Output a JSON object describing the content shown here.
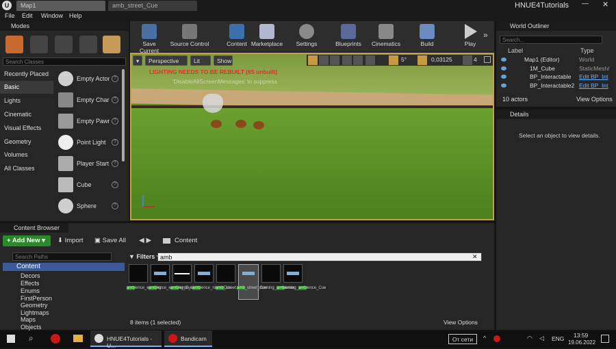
{
  "titlebar": {
    "tabs": [
      {
        "label": "Map1"
      },
      {
        "label": "amb_street_Cue"
      }
    ],
    "project": "HNUE4Tutorials"
  },
  "menu": [
    "File",
    "Edit",
    "Window",
    "Help"
  ],
  "modes": {
    "title": "Modes",
    "search_placeholder": "Search Classes",
    "categories": [
      "Recently Placed",
      "Basic",
      "Lights",
      "Cinematic",
      "Visual Effects",
      "Geometry",
      "Volumes",
      "All Classes"
    ],
    "items": [
      "Empty Actor",
      "Empty Chara",
      "Empty Pawn",
      "Point Light",
      "Player Start",
      "Cube",
      "Sphere"
    ]
  },
  "toolbar": [
    "Save Current",
    "Source Control",
    "Content",
    "Marketplace",
    "Settings",
    "Blueprints",
    "Cinematics",
    "Build",
    "Play"
  ],
  "viewport": {
    "perspective": "Perspective",
    "lit": "Lit",
    "show": "Show",
    "warning": "LIGHTING NEEDS TO BE REBUILT (65 unbuilt)",
    "suppress": "'DisableAllScreenMessages' to suppress",
    "snap_angle": "5°",
    "scale": "0,03125",
    "camera_speed": "4"
  },
  "outliner": {
    "title": "World Outliner",
    "search_placeholder": "Search...",
    "col_label": "Label",
    "col_type": "Type",
    "rows": [
      {
        "label": "Map1 (Editor)",
        "type": "World"
      },
      {
        "label": "1M_Cube",
        "type": "StaticMesh/"
      },
      {
        "label": "BP_Interactable",
        "type": "Edit BP_Int"
      },
      {
        "label": "BP_Interactable2",
        "type": "Edit BP_Int"
      }
    ],
    "count": "10 actors",
    "view_options": "View Options"
  },
  "details": {
    "title": "Details",
    "empty": "Select an object to view details."
  },
  "content_browser": {
    "title": "Content Browser",
    "add_new": "Add New",
    "import": "Import",
    "save_all": "Save All",
    "path": "Content",
    "search_paths": "Search Paths",
    "filters": "Filters",
    "search_value": "amb",
    "tree": [
      "Content",
      "Decors",
      "Effects",
      "Enums",
      "FirstPerson",
      "Geometry",
      "Lightmaps",
      "Maps",
      "Objects"
    ],
    "assets": [
      {
        "hl": "amb",
        "rest": "ience_evening"
      },
      {
        "hl": "amb",
        "rest": "ience_evening_Cue"
      },
      {
        "hl": "amb",
        "rest": "ience_night"
      },
      {
        "hl": "amb",
        "rest": "ience_night_Cue"
      },
      {
        "hl": "amb",
        "rest": "_street"
      },
      {
        "hl": "amb",
        "rest": "_street_Cue"
      },
      {
        "pre": "morning_",
        "hl": "amb",
        "rest": "ience"
      },
      {
        "pre": "morning_",
        "hl": "amb",
        "rest": "ience_Cue"
      }
    ],
    "status": "8 items (1 selected)",
    "view_options": "View Options"
  },
  "taskbar": {
    "app1": "HNUE4Tutorials - U...",
    "app2": "Bandicam",
    "network": "От сети",
    "lang": "ENG",
    "time": "13:59",
    "date": "19.06.2022"
  }
}
